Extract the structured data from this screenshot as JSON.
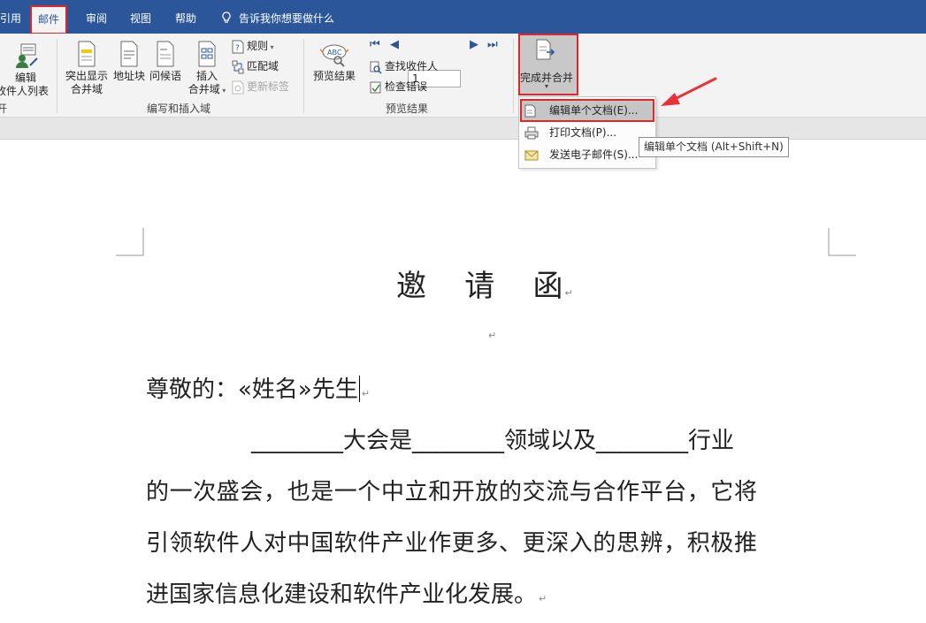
{
  "tabs": {
    "references_partial": "引用",
    "mailings": "邮件",
    "review": "审阅",
    "view": "视图",
    "help": "帮助",
    "tell_me": "告诉我你想要做什么"
  },
  "ribbon": {
    "edit_recipients": {
      "line1": "编辑",
      "line2": "收件人列表"
    },
    "start_group_partial": "开",
    "highlight_fields": {
      "line1": "突出显示",
      "line2": "合并域"
    },
    "address_block": "地址块",
    "greeting_line": "问候语",
    "insert_field": {
      "line1": "插入",
      "line2": "合并域"
    },
    "rules": "规则",
    "match_fields": "匹配域",
    "update_labels": "更新标签",
    "group_write_insert": "编写和插入域",
    "preview_results": "预览结果",
    "record_number": "1",
    "find_recipient": "查找收件人",
    "check_errors": "检查错误",
    "group_preview": "预览结果",
    "finish_merge": "完成并合并"
  },
  "finish_menu": {
    "items": [
      {
        "label": "编辑单个文档(E)..."
      },
      {
        "label": "打印文档(P)..."
      },
      {
        "label": "发送电子邮件(S)..."
      }
    ],
    "tooltip": "编辑单个文档 (Alt+Shift+N)"
  },
  "document": {
    "title": "邀    请    函",
    "salutation": "尊敬的：«姓名»先生",
    "body_lines": [
      "________大会是________领域以及________行业",
      "的一次盛会，也是一个中立和开放的交流与合作平台，它将",
      "引领软件人对中国软件产业作更多、更深入的思辨，积极推",
      "进国家信息化建设和软件产业化发展。"
    ],
    "para_mark": "↵"
  },
  "colors": {
    "ribbon_blue": "#2b579a",
    "highlight_red": "#e0262a",
    "annotation_arrow": "#e8323a"
  }
}
